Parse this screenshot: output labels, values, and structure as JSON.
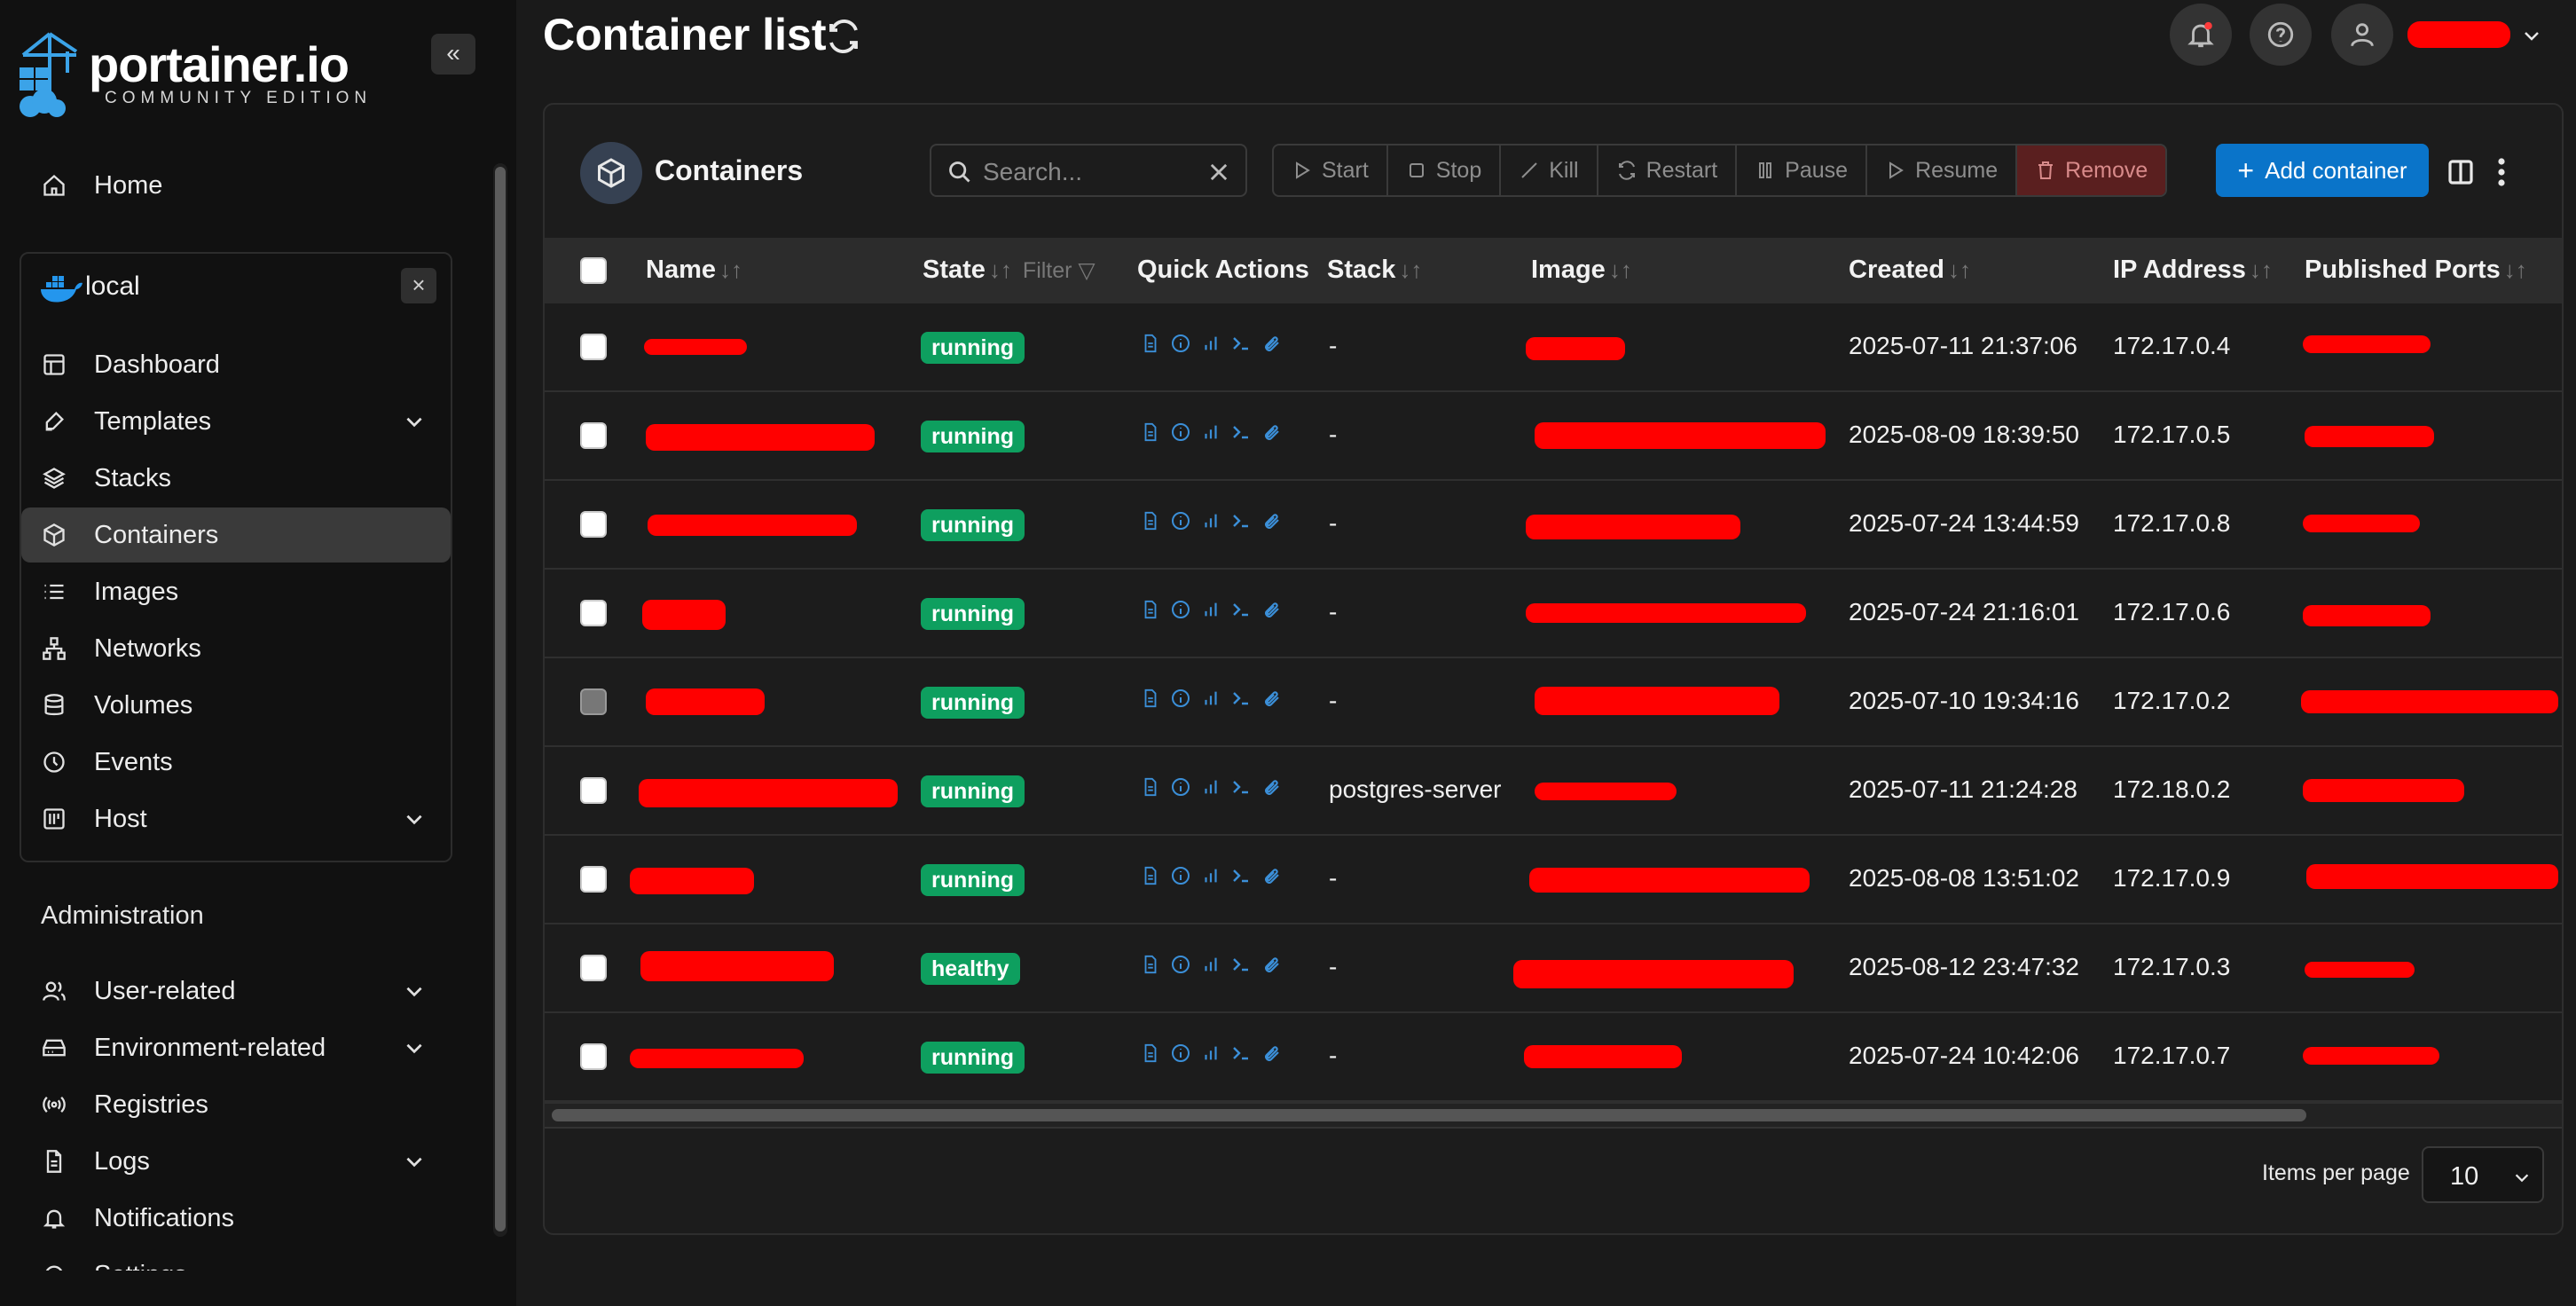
{
  "app": {
    "logo_word": "portainer.io",
    "logo_sub": "COMMUNITY EDITION",
    "page_title": "Container list"
  },
  "sidebar": {
    "home": "Home",
    "environment": "local",
    "env_items": [
      "Dashboard",
      "Templates",
      "Stacks",
      "Containers",
      "Images",
      "Networks",
      "Volumes",
      "Events",
      "Host"
    ],
    "admin_title": "Administration",
    "admin_items": [
      "User-related",
      "Environment-related",
      "Registries",
      "Logs",
      "Notifications",
      "Settings"
    ]
  },
  "panel": {
    "title": "Containers",
    "search_placeholder": "Search...",
    "actions": [
      "Start",
      "Stop",
      "Kill",
      "Restart",
      "Pause",
      "Resume",
      "Remove"
    ],
    "add_label": "Add container",
    "items_per_page_label": "Items per page",
    "items_per_page_value": "10"
  },
  "table": {
    "columns": {
      "name": "Name",
      "state": "State",
      "filter": "Filter",
      "quick_actions": "Quick Actions",
      "stack": "Stack",
      "image": "Image",
      "created": "Created",
      "ip": "IP Address",
      "ports": "Published Ports"
    },
    "rows": [
      {
        "state": "running",
        "stack": "-",
        "created": "2025-07-11 21:37:06",
        "ip": "172.17.0.4"
      },
      {
        "state": "running",
        "stack": "-",
        "created": "2025-08-09 18:39:50",
        "ip": "172.17.0.5"
      },
      {
        "state": "running",
        "stack": "-",
        "created": "2025-07-24 13:44:59",
        "ip": "172.17.0.8"
      },
      {
        "state": "running",
        "stack": "-",
        "created": "2025-07-24 21:16:01",
        "ip": "172.17.0.6"
      },
      {
        "state": "running",
        "stack": "-",
        "created": "2025-07-10 19:34:16",
        "ip": "172.17.0.2"
      },
      {
        "state": "running",
        "stack": "postgres-server",
        "created": "2025-07-11 21:24:28",
        "ip": "172.18.0.2"
      },
      {
        "state": "running",
        "stack": "-",
        "created": "2025-08-08 13:51:02",
        "ip": "172.17.0.9"
      },
      {
        "state": "healthy",
        "stack": "-",
        "created": "2025-08-12 23:47:32",
        "ip": "172.17.0.3"
      },
      {
        "state": "running",
        "stack": "-",
        "created": "2025-07-24 10:42:06",
        "ip": "172.17.0.7"
      }
    ]
  },
  "colors": {
    "accent": "#0a74c9",
    "status_green": "#0e9f5f",
    "redaction": "#ff0000",
    "remove_bg": "#5a1f1f",
    "icon_blue": "#3b8fd8"
  },
  "icons": [
    "home-icon",
    "docker-icon",
    "dashboard-icon",
    "templates-icon",
    "stacks-icon",
    "containers-icon",
    "images-icon",
    "networks-icon",
    "volumes-icon",
    "events-icon",
    "host-icon",
    "user-icon",
    "environment-icon",
    "registries-icon",
    "logs-icon",
    "bell-icon",
    "help-icon",
    "refresh-icon",
    "search-icon",
    "close-icon",
    "columns-icon",
    "more-icon"
  ]
}
